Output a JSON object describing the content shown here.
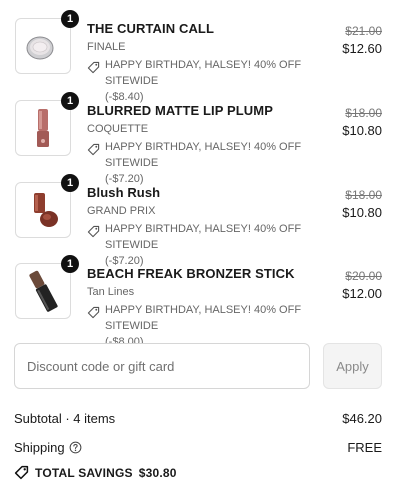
{
  "items": [
    {
      "quantity": "1",
      "title": "THE CURTAIN CALL",
      "variant": "FINALE",
      "discount_text": "HAPPY BIRTHDAY, HALSEY! 40% OFF SITEWIDE",
      "discount_amount": "(-$8.40)",
      "original_price": "$21.00",
      "price": "$12.60",
      "icon": "compact-powder"
    },
    {
      "quantity": "1",
      "title": "BLURRED MATTE LIP PLUMP",
      "variant": "COQUETTE",
      "discount_text": "HAPPY BIRTHDAY, HALSEY! 40% OFF SITEWIDE",
      "discount_amount": "(-$7.20)",
      "original_price": "$18.00",
      "price": "$10.80",
      "icon": "lip-gloss-tube"
    },
    {
      "quantity": "1",
      "title": "Blush Rush",
      "variant": "GRAND PRIX",
      "discount_text": "HAPPY BIRTHDAY, HALSEY! 40% OFF SITEWIDE",
      "discount_amount": "(-$7.20)",
      "original_price": "$18.00",
      "price": "$10.80",
      "icon": "blush-tube"
    },
    {
      "quantity": "1",
      "title": "BEACH FREAK BRONZER STICK",
      "variant": "Tan Lines",
      "discount_text": "HAPPY BIRTHDAY, HALSEY! 40% OFF SITEWIDE",
      "discount_amount": "(-$8.00)",
      "original_price": "$20.00",
      "price": "$12.00",
      "icon": "bronzer-stick"
    }
  ],
  "discount": {
    "placeholder": "Discount code or gift card",
    "apply_label": "Apply"
  },
  "summary": {
    "subtotal_label": "Subtotal · 4 items",
    "subtotal_value": "$46.20",
    "shipping_label": "Shipping",
    "shipping_value": "FREE",
    "savings_label": "TOTAL SAVINGS",
    "savings_value": "$30.80"
  },
  "colors": {
    "badge": "#111111",
    "muted_text": "#666666",
    "button_disabled_bg": "#f4f4f4"
  }
}
